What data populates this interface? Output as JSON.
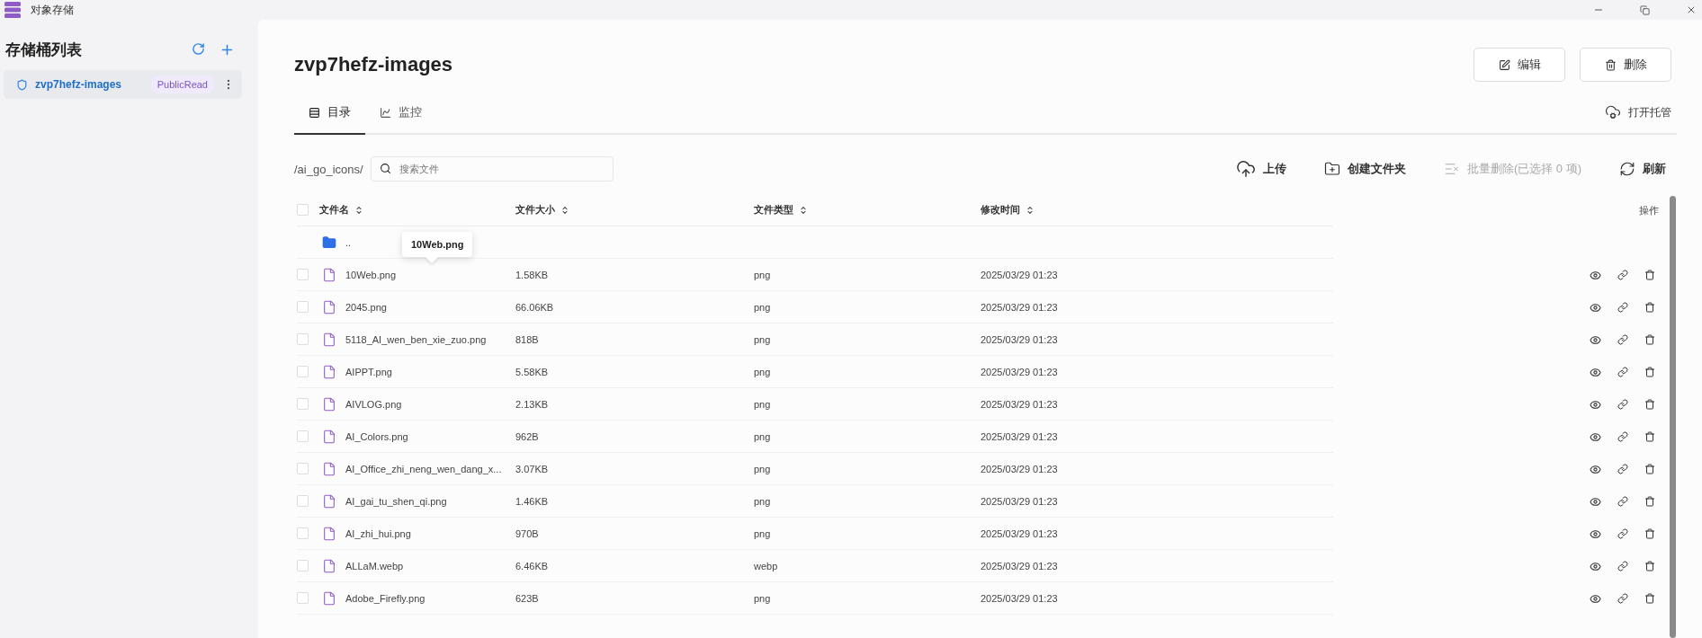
{
  "window": {
    "title": "对象存储"
  },
  "sidebar": {
    "title": "存储桶列表",
    "buckets": [
      {
        "name": "zvp7hefz-images",
        "badge": "PublicRead",
        "selected": true
      }
    ]
  },
  "bucket": {
    "title": "zvp7hefz-images",
    "buttons": [
      {
        "kind": "edit",
        "label": "编辑"
      },
      {
        "kind": "delete",
        "label": "删除"
      }
    ]
  },
  "tabs": [
    {
      "kind": "directory",
      "label": "目录",
      "selected": true
    },
    {
      "kind": "monitor",
      "label": "监控",
      "selected": false
    }
  ],
  "hosting_link": "打开托管",
  "toolbar": {
    "path": "/ai_go_icons/",
    "search_placeholder": "搜索文件",
    "actions": [
      {
        "kind": "upload",
        "label": "上传",
        "disabled": false
      },
      {
        "kind": "new-folder",
        "label": "创建文件夹",
        "disabled": false
      },
      {
        "kind": "batch-delete",
        "label": "批量删除(已选择 0 项)",
        "disabled": true
      },
      {
        "kind": "refresh",
        "label": "刷新",
        "disabled": false
      }
    ]
  },
  "table": {
    "select_all_checked": false,
    "columns": [
      "文件名",
      "文件大小",
      "文件类型",
      "修改时间"
    ],
    "actions_column": "操作",
    "tooltip": "10Web.png",
    "rows": [
      {
        "kind": "folder",
        "name": ".."
      },
      {
        "kind": "file",
        "name": "10Web.png",
        "size": "1.58KB",
        "type": "png",
        "modified": "2025/03/29 01:23",
        "checked": false
      },
      {
        "kind": "file",
        "name": "2045.png",
        "size": "66.06KB",
        "type": "png",
        "modified": "2025/03/29 01:23",
        "checked": false
      },
      {
        "kind": "file",
        "name": "5118_AI_wen_ben_xie_zuo.png",
        "size": "818B",
        "type": "png",
        "modified": "2025/03/29 01:23",
        "checked": false
      },
      {
        "kind": "file",
        "name": "AIPPT.png",
        "size": "5.58KB",
        "type": "png",
        "modified": "2025/03/29 01:23",
        "checked": false
      },
      {
        "kind": "file",
        "name": "AIVLOG.png",
        "size": "2.13KB",
        "type": "png",
        "modified": "2025/03/29 01:23",
        "checked": false
      },
      {
        "kind": "file",
        "name": "AI_Colors.png",
        "size": "962B",
        "type": "png",
        "modified": "2025/03/29 01:23",
        "checked": false
      },
      {
        "kind": "file",
        "name": "AI_Office_zhi_neng_wen_dang_x...",
        "size": "3.07KB",
        "type": "png",
        "modified": "2025/03/29 01:23",
        "checked": false
      },
      {
        "kind": "file",
        "name": "AI_gai_tu_shen_qi.png",
        "size": "1.46KB",
        "type": "png",
        "modified": "2025/03/29 01:23",
        "checked": false
      },
      {
        "kind": "file",
        "name": "AI_zhi_hui.png",
        "size": "970B",
        "type": "png",
        "modified": "2025/03/29 01:23",
        "checked": false
      },
      {
        "kind": "file",
        "name": "ALLaM.webp",
        "size": "6.46KB",
        "type": "webp",
        "modified": "2025/03/29 01:23",
        "checked": false
      },
      {
        "kind": "file",
        "name": "Adobe_Firefly.png",
        "size": "623B",
        "type": "png",
        "modified": "2025/03/29 01:23",
        "checked": false
      }
    ]
  }
}
